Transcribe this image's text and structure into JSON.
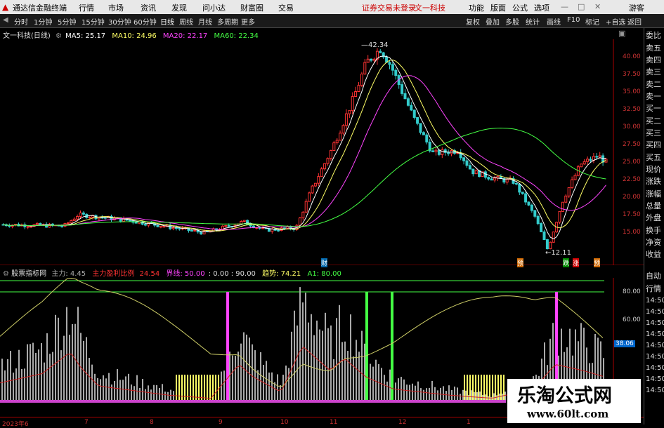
{
  "titlebar": {
    "app_name": "通达信金融终端",
    "menu": [
      "行情",
      "市场",
      "资讯",
      "发现",
      "问小达",
      "财富圈",
      "交易"
    ],
    "login_status": "证券交易未登录",
    "stock_name": "文一科技",
    "right_menu": [
      "功能",
      "版面",
      "公式",
      "选项"
    ],
    "guest": "游客"
  },
  "toolbar": {
    "periods": [
      "分时",
      "1分钟",
      "5分钟",
      "15分钟",
      "30分钟",
      "60分钟",
      "日线",
      "周线",
      "月线",
      "多周期",
      "更多"
    ],
    "right_buttons": [
      "复权",
      "叠加",
      "多股",
      "统计",
      "画线",
      "F10",
      "标记",
      "+自选",
      "返回"
    ]
  },
  "chart_header": {
    "stock_label": "文一科技(日线)",
    "ma5": "MA5: 25.17",
    "ma10": "MA10: 24.96",
    "ma20": "MA20: 22.17",
    "ma60": "MA60: 22.34"
  },
  "price_axis": {
    "ticks": [
      "40.00",
      "37.50",
      "35.00",
      "32.50",
      "30.00",
      "27.50",
      "25.00",
      "22.50",
      "20.00",
      "17.50",
      "15.00"
    ],
    "high_label": "42.34",
    "low_label": "12.11"
  },
  "event_markers": [
    "财",
    "预",
    "跌",
    "涨",
    "预"
  ],
  "indicator_header": {
    "name": "股票指标网",
    "main": "主力: 4.45",
    "ratio": "主力盈利比例",
    "ratio_val": "24.54",
    "boundary": "界线: 50.00",
    "levels": ": 0.00 : 90.00",
    "trend": "趋势: 74.21",
    "a1": "A1: 80.00"
  },
  "indicator_axis": {
    "ticks": [
      "80.00",
      "60.00"
    ],
    "current": "38.06"
  },
  "right_panel": {
    "items": [
      "委比",
      "卖五",
      "卖四",
      "卖三",
      "卖二",
      "卖一",
      "买一",
      "买二",
      "买三",
      "买四",
      "买五",
      "现价",
      "涨跌",
      "涨幅",
      "总量",
      "外盘",
      "换手",
      "净资",
      "收益"
    ],
    "lower": [
      "自动",
      "行情",
      "14:50",
      "14:50",
      "14:50",
      "14:50",
      "14:50",
      "14:50",
      "14:50",
      "14:50",
      "14:50"
    ]
  },
  "bottom_axis": {
    "labels": [
      "2023年6",
      "7",
      "8",
      "9",
      "10",
      "11",
      "12",
      "1"
    ]
  },
  "watermark": {
    "title": "乐淘公式网",
    "url": "www.60lt.com"
  },
  "colors": {
    "up": "#ff3333",
    "down": "#33cccc",
    "ma5": "#ffffff",
    "ma10": "#ffff66",
    "ma20": "#ff44ff",
    "ma60": "#44ff44"
  }
}
